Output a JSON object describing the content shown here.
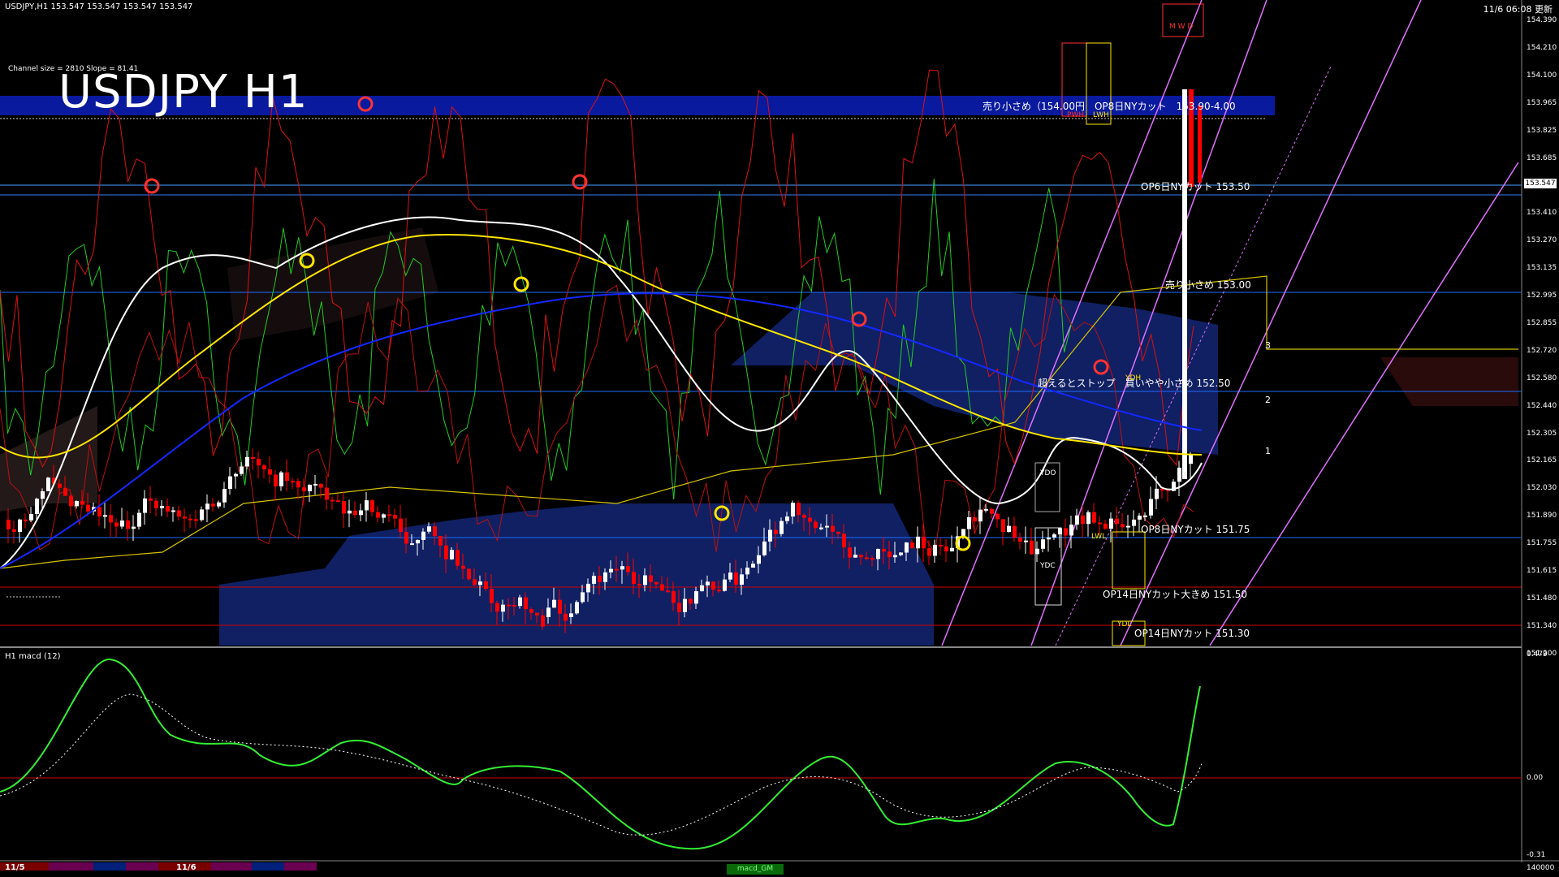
{
  "window": {
    "symbol_info": "USDJPY,H1  153.547 153.547 153.547 153.547",
    "timestamp": "11/6 06:08 更新",
    "channel_info": "Channel size = 2810  Slope = 81.41",
    "title": "USDJPY H1"
  },
  "price_axis": {
    "ticks": [
      "154.390",
      "154.210",
      "154.100",
      "153.965",
      "153.825",
      "153.685",
      "153.550",
      "153.410",
      "153.270",
      "153.135",
      "152.995",
      "152.855",
      "152.720",
      "152.580",
      "152.440",
      "152.305",
      "152.165",
      "152.030",
      "151.890",
      "151.755",
      "151.615",
      "151.480",
      "151.340",
      "151.200"
    ],
    "current_price": "153.547"
  },
  "level_labels": {
    "sell_zone": "売り小さめ（154.00円　OP8日NYカット　153.90-4.00",
    "op6": "OP6日NYカット 153.50",
    "sell_small": "売り小さめ 153.00",
    "buy_stop": "超えるとストップ　買いやや小さめ 152.50",
    "op8": "OP8日NYカット 151.75",
    "op14_big": "OP14日NYカット大きめ 151.50",
    "op14": "OP14日NYカット 151.30"
  },
  "box_labels": {
    "ydo": "YDO",
    "ydc": "YDC",
    "ydl": "YDL",
    "lwl": "LWL",
    "lwh": "LWH",
    "pwh": "PWH",
    "mwd": "M W D",
    "ydh": "YDH"
  },
  "fib_labels": [
    "3",
    "2",
    "1"
  ],
  "macd_panel": {
    "label": "H1  macd (12)",
    "ticks": [
      "0.479",
      "0.00",
      "-0.31"
    ],
    "volume_tick": "140000"
  },
  "time_axis": {
    "dates": [
      "11/5",
      "11/6"
    ],
    "tab_label": "macd_GM"
  },
  "colors": {
    "background": "#000000",
    "bull_candle": "#ffffff",
    "bear_candle": "#ff0000",
    "sell_zone_band": "#0a1a9e",
    "level_line_blue": "#1e6cff",
    "level_line_red": "#cc0000",
    "ma_white": "#ffffff",
    "ma_yellow": "#ffe600",
    "ma_blue": "#1428ff",
    "channel_violet": "#e070ff",
    "macd_main_up": "#33ee33",
    "macd_main_down": "#ff88bb",
    "macd_signal": "#ffffff",
    "ichimoku_cloud": "#12246e"
  }
}
